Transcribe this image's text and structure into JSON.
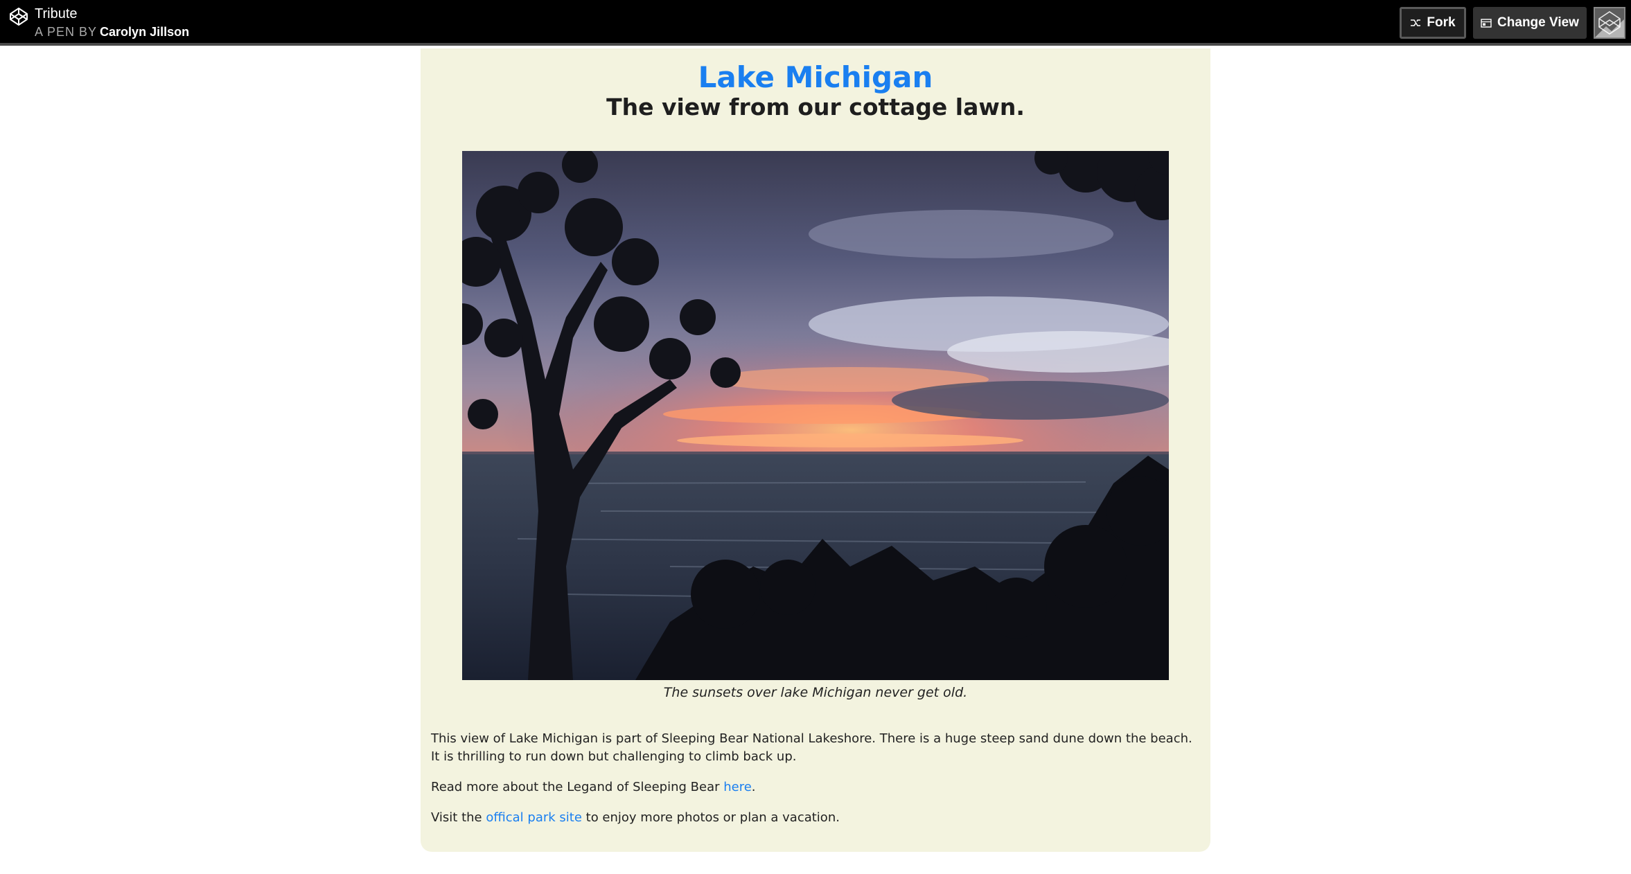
{
  "topbar": {
    "pen_title": "Tribute",
    "byline_prefix": "A PEN BY",
    "author": "Carolyn Jillson",
    "fork_label": "Fork",
    "change_view_label": "Change View",
    "brand_icon": "codepen-logo-icon",
    "fork_icon": "fork-icon",
    "change_view_icon": "layout-icon",
    "avatar_icon": "user-avatar"
  },
  "tribute": {
    "title": "Lake Michigan",
    "subtitle": "The view from our cottage lawn.",
    "caption": "The sunsets over lake Michigan never get old.",
    "paragraph1": "This view of Lake Michigan is part of Sleeping Bear National Lakeshore. There is a huge steep sand dune down the beach. It is thrilling to run down but challenging to climb back up.",
    "paragraph2_before": "Read more about the Legand of Sleeping Bear ",
    "paragraph2_link": "here",
    "paragraph2_after": ".",
    "paragraph3_before": "Visit the ",
    "paragraph3_link": "offical park site",
    "paragraph3_after": " to enjoy more photos or plan a vacation."
  },
  "colors": {
    "topbar_bg": "#000000",
    "card_bg": "#f3f3df",
    "link": "#1a7ff0",
    "text": "#1e1e1e"
  }
}
